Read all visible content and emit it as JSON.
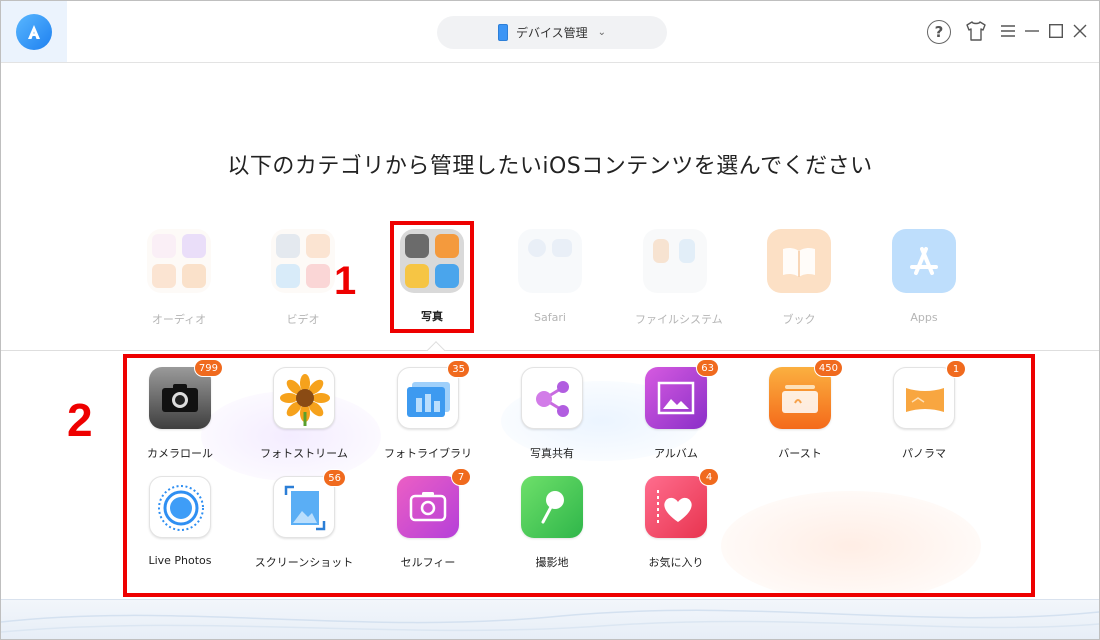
{
  "device_selector": {
    "label": "デバイス管理"
  },
  "headline": "以下のカテゴリから管理したいiOSコンテンツを選んでください",
  "categories": [
    {
      "label": "オーディオ",
      "icon": "audio-icon"
    },
    {
      "label": "ビデオ",
      "icon": "video-icon"
    },
    {
      "label": "写真",
      "icon": "photos-icon",
      "active": true
    },
    {
      "label": "Safari",
      "icon": "safari-icon"
    },
    {
      "label": "ファイルシステム",
      "icon": "file-system-icon"
    },
    {
      "label": "ブック",
      "icon": "book-icon"
    },
    {
      "label": "Apps",
      "icon": "apps-icon"
    }
  ],
  "annotations": {
    "one": "1",
    "two": "2"
  },
  "tiles": [
    {
      "label": "カメラロール",
      "badge": "799",
      "icon": "camera-icon"
    },
    {
      "label": "フォトストリーム",
      "badge": "",
      "icon": "sunflower-icon"
    },
    {
      "label": "フォトライブラリ",
      "badge": "35",
      "icon": "photo-library-icon"
    },
    {
      "label": "写真共有",
      "badge": "",
      "icon": "share-icon"
    },
    {
      "label": "アルバム",
      "badge": "63",
      "icon": "album-icon"
    },
    {
      "label": "バースト",
      "badge": "450",
      "icon": "burst-icon"
    },
    {
      "label": "パノラマ",
      "badge": "1",
      "icon": "panorama-icon"
    },
    {
      "label": "Live Photos",
      "badge": "",
      "icon": "live-photos-icon"
    },
    {
      "label": "スクリーンショット",
      "badge": "56",
      "icon": "screenshot-icon"
    },
    {
      "label": "セルフィー",
      "badge": "7",
      "icon": "selfie-icon"
    },
    {
      "label": "撮影地",
      "badge": "",
      "icon": "location-pin-icon"
    },
    {
      "label": "お気に入り",
      "badge": "4",
      "icon": "heart-icon"
    }
  ],
  "colors": {
    "accent": "#1e80f0",
    "annotation": "#e00000",
    "badge": "#f06a1e"
  }
}
